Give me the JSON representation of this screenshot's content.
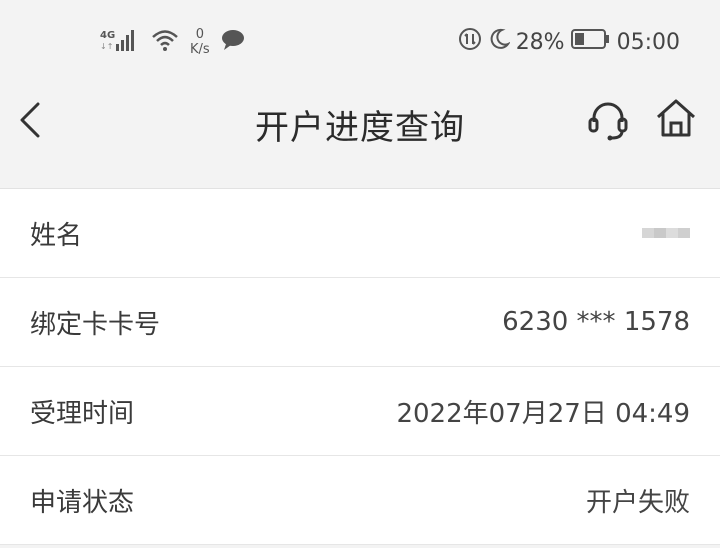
{
  "status_bar": {
    "network": "4G",
    "speed_value": "0",
    "speed_unit": "K/s",
    "battery_percent": "28%",
    "time": "05:00"
  },
  "nav": {
    "title": "开户进度查询"
  },
  "rows": [
    {
      "label": "姓名",
      "value": ""
    },
    {
      "label": "绑定卡卡号",
      "value": "6230 *** 1578"
    },
    {
      "label": "受理时间",
      "value": "2022年07月27日 04:49"
    },
    {
      "label": "申请状态",
      "value": "开户失败"
    }
  ],
  "colors": {
    "background": "#f3f3f3",
    "card": "#ffffff",
    "text": "#333333"
  }
}
